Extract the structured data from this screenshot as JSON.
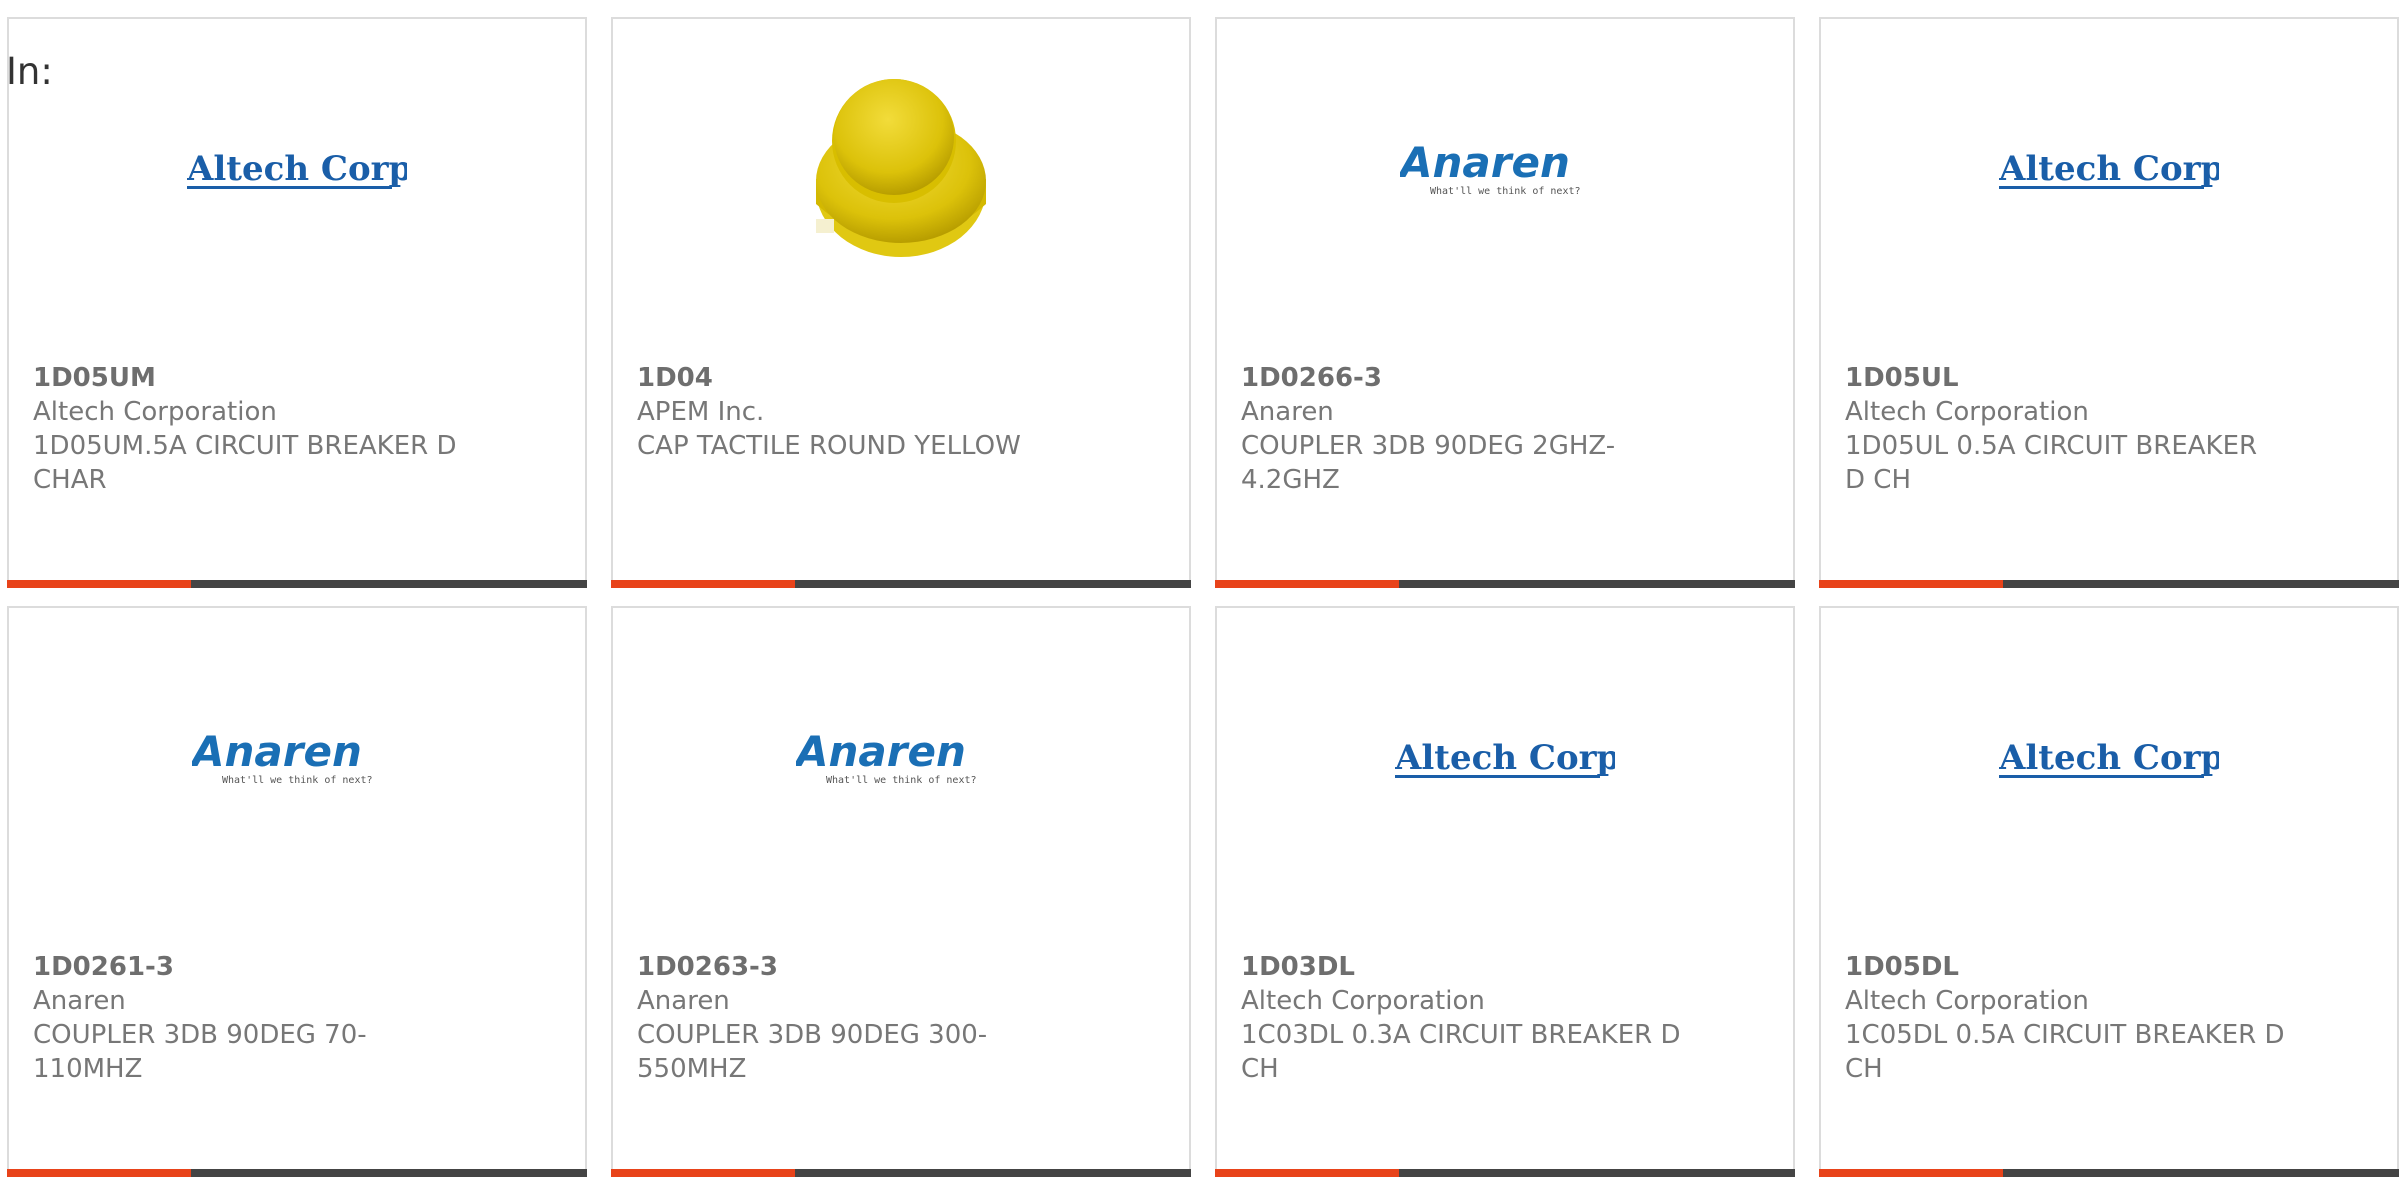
{
  "filter_label": "In:",
  "colors": {
    "accent": "#e8431a",
    "bar": "#444444",
    "altech_blue": "#1a5ea8",
    "anaren_blue": "#1a6fb5",
    "cap_yellow": "#e8c800"
  },
  "products": [
    {
      "part": "1D05UM",
      "maker": "Altech Corporation",
      "desc": "1D05UM.5A CIRCUIT BREAKER D CHAR",
      "logo": "altech-logo"
    },
    {
      "part": "1D04",
      "maker": "APEM Inc.",
      "desc": "CAP TACTILE ROUND YELLOW",
      "logo": "yellow-cap-image"
    },
    {
      "part": "1D0266-3",
      "maker": "Anaren",
      "desc": "COUPLER 3DB 90DEG 2GHZ-4.2GHZ",
      "logo": "anaren-logo"
    },
    {
      "part": "1D05UL",
      "maker": "Altech Corporation",
      "desc": "1D05UL 0.5A CIRCUIT BREAKER D CH",
      "logo": "altech-logo"
    },
    {
      "part": "1D0261-3",
      "maker": "Anaren",
      "desc": "COUPLER 3DB 90DEG 70-110MHZ",
      "logo": "anaren-logo"
    },
    {
      "part": "1D0263-3",
      "maker": "Anaren",
      "desc": "COUPLER 3DB 90DEG 300-550MHZ",
      "logo": "anaren-logo"
    },
    {
      "part": "1D03DL",
      "maker": "Altech Corporation",
      "desc": "1C03DL 0.3A CIRCUIT BREAKER D CH",
      "logo": "altech-logo"
    },
    {
      "part": "1D05DL",
      "maker": "Altech Corporation",
      "desc": "1C05DL 0.5A CIRCUIT BREAKER D CH",
      "logo": "altech-logo"
    }
  ],
  "logos": {
    "altech_text": "Altech Corp.",
    "anaren_text": "Anaren",
    "anaren_tagline": "What'll we think of next?"
  }
}
